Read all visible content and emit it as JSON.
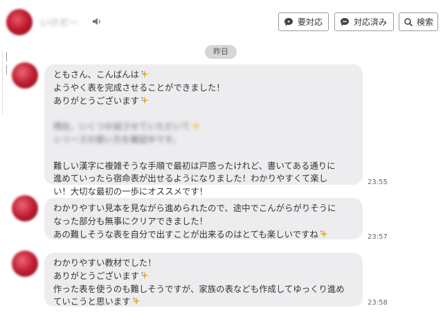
{
  "header": {
    "contact_name": "いけだー",
    "buttons": {
      "needs_response": "要対応",
      "responded": "対応済み",
      "search": "検索"
    }
  },
  "date_divider": "昨日",
  "messages": [
    {
      "time": "23:55",
      "lines": [
        {
          "text": "ともさん、こんばんは",
          "sparkle": true
        },
        {
          "text": "ようやく表を完成させることができました！",
          "sparkle": false
        },
        {
          "text": "ありがとうございます",
          "sparkle": true
        },
        {
          "blank": true
        },
        {
          "text": "現在、いくつか試させていただいて",
          "blurred": true,
          "sparkle": true
        },
        {
          "text": "シリーズの使い方を確認中です。",
          "blurred": true
        },
        {
          "blank": true
        },
        {
          "text": "難しい漢字に複雑そうな手順で最初は戸惑ったけれど、書いてある通りに",
          "sparkle": false
        },
        {
          "text": "進めていったら宿命表が出せるようになりました！わかりやすくて楽し",
          "sparkle": false
        },
        {
          "text": "い！大切な最初の一歩にオススメです！",
          "sparkle": false
        }
      ]
    },
    {
      "time": "23:57",
      "lines": [
        {
          "text": "わかりやすい見本を見ながら進められたので、途中でこんがらがりそうに",
          "sparkle": false
        },
        {
          "text": "なった部分も無事にクリアできました！",
          "sparkle": false
        },
        {
          "text": "あの難しそうな表を自分で出すことが出来るのはとても楽しいですね",
          "sparkle": true
        }
      ]
    },
    {
      "time": "23:58",
      "lines": [
        {
          "text": "わかりやすい教材でした！",
          "sparkle": false
        },
        {
          "text": "ありがとうございます",
          "sparkle": true
        },
        {
          "text": "作った表を使うのも難しそうですが、家族の表なども作成してゆっくり進め",
          "sparkle": false
        },
        {
          "text": "ていこうと思います",
          "sparkle": true
        }
      ]
    }
  ],
  "icons": {
    "sparkle_color": "#e6b422",
    "sparkle_accent": "#8a7ad0"
  }
}
